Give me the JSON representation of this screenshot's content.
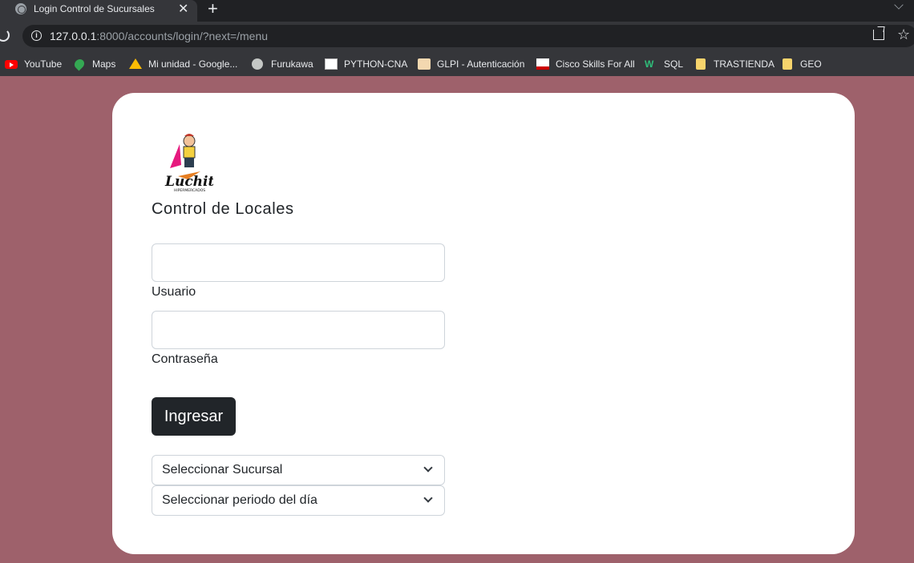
{
  "browser": {
    "tab_title": "Login Control de Sucursales",
    "url_host": "127.0.0.1",
    "url_rest": ":8000/accounts/login/?next=/menu",
    "bookmarks": [
      {
        "label": "YouTube",
        "icon": "youtube-icon"
      },
      {
        "label": "Maps",
        "icon": "maps-icon"
      },
      {
        "label": "Mi unidad - Google...",
        "icon": "google-drive-icon"
      },
      {
        "label": "Furukawa",
        "icon": "globe-icon"
      },
      {
        "label": "PYTHON-CNA",
        "icon": "cisco-icon"
      },
      {
        "label": "GLPI - Autenticación",
        "icon": "glpi-icon"
      },
      {
        "label": "Cisco Skills For All",
        "icon": "cisco-icon"
      },
      {
        "label": "SQL",
        "icon": "w-icon"
      },
      {
        "label": "TRASTIENDA",
        "icon": "folder-icon"
      },
      {
        "label": "GEO",
        "icon": "folder-icon"
      }
    ]
  },
  "page": {
    "heading": "Control de Locales",
    "logo_text": "Luchito",
    "logo_subtext": "HIPERMERCADOS",
    "username_label": "Usuario",
    "username_value": "",
    "password_label": "Contraseña",
    "password_value": "",
    "submit_label": "Ingresar",
    "branch_select": "Seleccionar Sucursal",
    "period_select": "Seleccionar periodo del día"
  },
  "colors": {
    "page_background": "#9e616b",
    "card_background": "#ffffff",
    "button": "#212529"
  }
}
